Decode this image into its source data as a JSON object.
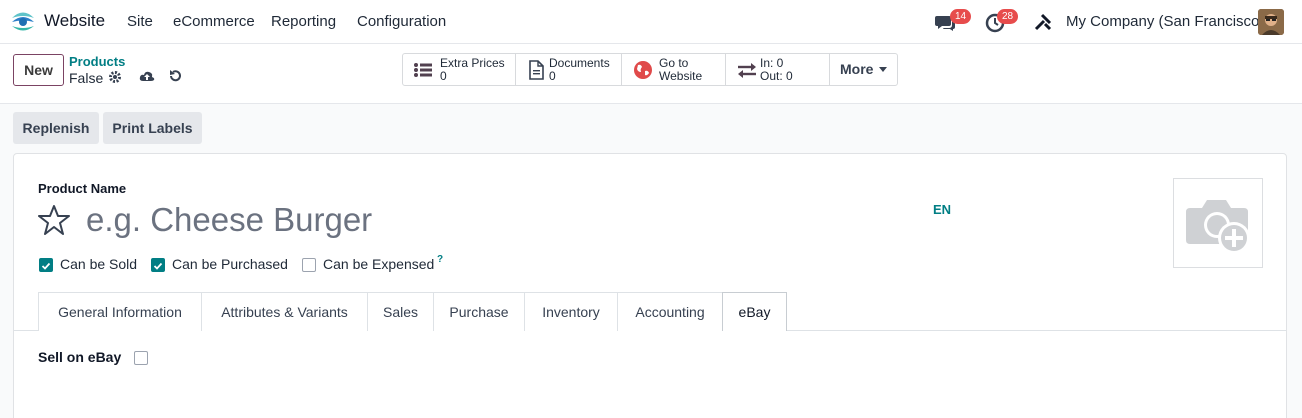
{
  "navbar": {
    "app_name": "Website",
    "menu": [
      "Site",
      "eCommerce",
      "Reporting",
      "Configuration"
    ],
    "messages_count": "14",
    "activities_count": "28",
    "company": "My Company (San Francisco)"
  },
  "control_panel": {
    "new_label": "New",
    "breadcrumb": "Products",
    "record_name": "False",
    "smart_buttons": [
      {
        "label": "Extra Prices",
        "value": "0",
        "icon": "list-icon"
      },
      {
        "label": "Documents",
        "value": "0",
        "icon": "document-icon"
      },
      {
        "label": "Go to",
        "value": "Website",
        "icon": "globe-icon"
      },
      {
        "label": "In: 0",
        "value": "Out: 0",
        "icon": "transfer-arrows-icon"
      }
    ],
    "more_label": "More"
  },
  "actions": {
    "replenish": "Replenish",
    "print_labels": "Print Labels"
  },
  "form": {
    "product_name_label": "Product Name",
    "name_placeholder": "e.g. Cheese Burger",
    "lang": "EN",
    "checkboxes": [
      {
        "label": "Can be Sold",
        "checked": true
      },
      {
        "label": "Can be Purchased",
        "checked": true
      },
      {
        "label": "Can be Expensed",
        "checked": false
      }
    ],
    "help_mark": "?",
    "tabs": [
      "General Information",
      "Attributes & Variants",
      "Sales",
      "Purchase",
      "Inventory",
      "Accounting",
      "eBay"
    ],
    "active_tab": "eBay",
    "ebay_field_label": "Sell on eBay",
    "sell_on_ebay": false
  },
  "colors": {
    "accent_teal": "#017e84",
    "primary_purple": "#7b4363",
    "badge_red": "#e74c4c"
  }
}
